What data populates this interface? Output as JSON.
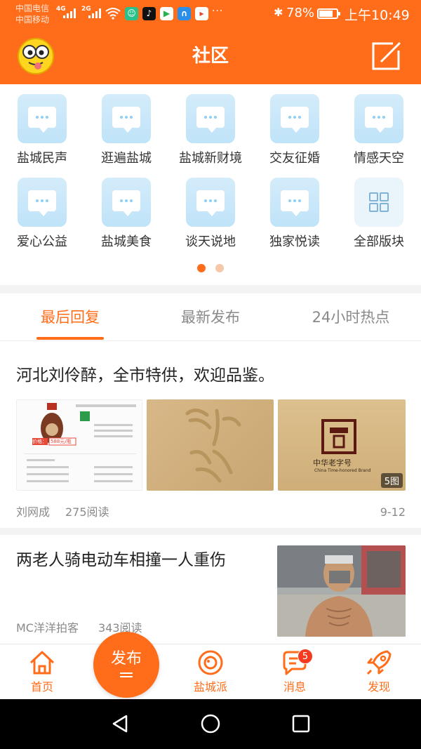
{
  "status_bar": {
    "carrier_1": "中国电信",
    "carrier_2": "中国移动",
    "signal_1_label": "4G",
    "signal_2_label": "2G",
    "app_icons": [
      "mi-icon",
      "tiktok-icon",
      "video-icon",
      "browser-icon",
      "play-icon"
    ],
    "more_dots": "···",
    "bluetooth": "✱",
    "battery_percent": "78%",
    "battery_level": 0.78,
    "time": "上午10:49"
  },
  "header": {
    "title": "社区",
    "avatar_icon": "emoji-face-icon",
    "edit_icon": "edit-icon",
    "color": "#ff6d1a"
  },
  "categories": [
    {
      "label": "盐城民声",
      "icon": "chat-icon"
    },
    {
      "label": "逛遍盐城",
      "icon": "chat-icon"
    },
    {
      "label": "盐城新财境",
      "icon": "chat-icon"
    },
    {
      "label": "交友征婚",
      "icon": "chat-icon"
    },
    {
      "label": "情感天空",
      "icon": "chat-icon"
    },
    {
      "label": "爱心公益",
      "icon": "chat-icon"
    },
    {
      "label": "盐城美食",
      "icon": "chat-icon"
    },
    {
      "label": "谈天说地",
      "icon": "chat-icon"
    },
    {
      "label": "独家悦读",
      "icon": "chat-icon"
    },
    {
      "label": "全部版块",
      "icon": "grid-icon"
    }
  ],
  "pager": {
    "active_index": 0,
    "count": 2,
    "active_color": "#ff6d1a",
    "inactive_color": "#f6c8a8"
  },
  "tabs": [
    {
      "label": "最后回复",
      "active": true
    },
    {
      "label": "最新发布",
      "active": false
    },
    {
      "label": "24小时热点",
      "active": false
    }
  ],
  "posts": [
    {
      "title": "河北刘伶醉，全市特供，欢迎品鉴。",
      "author": "刘网成",
      "reads": "275阅读",
      "date": "9-12",
      "image_count": "5图",
      "price_tag": "588元/瓶",
      "price_prefix": "价格：",
      "brand_text": "中华老字号",
      "brand_sub": "China Time-honored Brand"
    },
    {
      "title": "两老人骑电动车相撞一人重伤",
      "author": "MC洋洋拍客",
      "reads": "343阅读"
    }
  ],
  "bottom_nav": {
    "home": "首页",
    "publish": "发布",
    "yancheng": "盐城派",
    "messages": "消息",
    "messages_badge": "5",
    "discover": "发现"
  },
  "system_nav": [
    "back-icon",
    "home-circle-icon",
    "recents-icon"
  ]
}
